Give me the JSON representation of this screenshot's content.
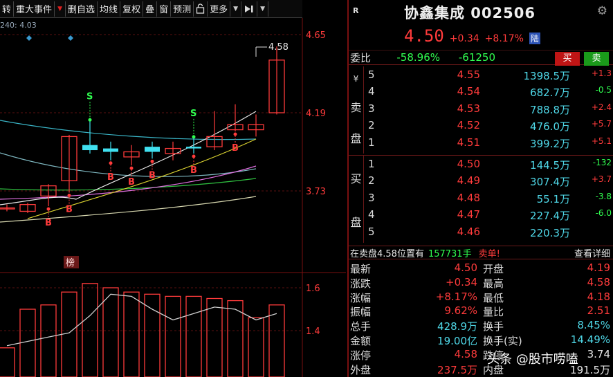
{
  "toolbar": {
    "items": [
      "转",
      "重大事件",
      "删自选",
      "均线",
      "复权",
      "叠",
      "窗",
      "预测",
      "更多"
    ],
    "lock_icon": "lock-icon",
    "play_icon": "play-to-end-icon"
  },
  "chart": {
    "ma_label": "240: 4.03",
    "price_ticks": [
      "4.65",
      "4.19",
      "3.73"
    ],
    "max_label": "4.58",
    "volume_ticks": [
      "1.6",
      "1.4"
    ],
    "bang_label": "榜",
    "buy_mark": "B",
    "sell_mark": "S"
  },
  "chart_data": {
    "type": "candlestick",
    "ylim": [
      3.5,
      4.7
    ],
    "candles": [
      {
        "open": 3.63,
        "close": 3.63,
        "high": 3.65,
        "low": 3.61
      },
      {
        "open": 3.61,
        "close": 3.65,
        "high": 3.66,
        "low": 3.6
      },
      {
        "open": 3.7,
        "close": 3.76,
        "high": 3.77,
        "low": 3.64
      },
      {
        "open": 3.79,
        "close": 4.05,
        "high": 4.06,
        "low": 3.72
      },
      {
        "open": 4.0,
        "close": 3.97,
        "high": 4.14,
        "low": 3.95
      },
      {
        "open": 3.98,
        "close": 3.96,
        "high": 4.02,
        "low": 3.91
      },
      {
        "open": 3.93,
        "close": 3.96,
        "high": 4.0,
        "low": 3.88
      },
      {
        "open": 3.99,
        "close": 3.96,
        "high": 4.02,
        "low": 3.92
      },
      {
        "open": 3.95,
        "close": 3.98,
        "high": 4.02,
        "low": 3.91
      },
      {
        "open": 3.99,
        "close": 3.98,
        "high": 4.04,
        "low": 3.95
      },
      {
        "open": 3.99,
        "close": 4.05,
        "high": 4.2,
        "low": 3.97
      },
      {
        "open": 4.09,
        "close": 4.12,
        "high": 4.24,
        "low": 4.08
      },
      {
        "open": 4.09,
        "close": 4.12,
        "high": 4.18,
        "low": 4.05
      },
      {
        "open": 4.19,
        "close": 4.5,
        "high": 4.58,
        "low": 4.18
      }
    ],
    "volume": [
      1.32,
      1.5,
      1.52,
      1.58,
      1.62,
      1.6,
      1.58,
      1.57,
      1.56,
      1.56,
      1.55,
      1.54,
      1.46,
      1.52
    ],
    "volume_line": [
      1.33,
      1.35,
      1.37,
      1.39,
      1.47,
      1.57,
      1.56,
      1.5,
      1.45,
      1.48,
      1.51,
      1.5,
      1.45,
      1.48
    ],
    "volume_ylim": [
      1.2,
      1.7
    ],
    "buy_signals": [
      2,
      3,
      5,
      6,
      7,
      9,
      11
    ],
    "sell_signals": [
      4,
      9
    ]
  },
  "quote": {
    "r_label": "R",
    "title": "协鑫集成 002506",
    "price": "4.50",
    "change": "+0.34",
    "change_pct": "+8.17%",
    "lu_badge": "陆",
    "weibi_label": "委比",
    "weibi_pct": "-58.96%",
    "weibi_diff": "-61250",
    "buy_btn": "买",
    "sell_btn": "卖",
    "ask_side_labels": [
      "¥",
      "卖",
      "盘"
    ],
    "bid_side_labels": [
      "买",
      "盘"
    ],
    "asks": [
      {
        "level": "5",
        "price": "4.55",
        "vol": "1398.5万",
        "delta": "+1.3"
      },
      {
        "level": "4",
        "price": "4.54",
        "vol": "682.7万",
        "delta": "-0.5"
      },
      {
        "level": "3",
        "price": "4.53",
        "vol": "788.8万",
        "delta": "+2.4"
      },
      {
        "level": "2",
        "price": "4.52",
        "vol": "476.0万",
        "delta": "+5.7"
      },
      {
        "level": "1",
        "price": "4.51",
        "vol": "399.2万",
        "delta": "+5.1"
      }
    ],
    "bids": [
      {
        "level": "1",
        "price": "4.50",
        "vol": "144.5万",
        "delta": "-132"
      },
      {
        "level": "2",
        "price": "4.49",
        "vol": "307.4万",
        "delta": "+3.7"
      },
      {
        "level": "3",
        "price": "4.48",
        "vol": "55.1万",
        "delta": "-3.8"
      },
      {
        "level": "4",
        "price": "4.47",
        "vol": "227.4万",
        "delta": "-6.0"
      },
      {
        "level": "5",
        "price": "4.46",
        "vol": "220.3万",
        "delta": ""
      }
    ],
    "info_line": {
      "text": "在卖盘4.58位置有",
      "qty": "157731手",
      "tag": "卖单!",
      "link": "查看详细"
    },
    "stats": [
      {
        "l1": "最新",
        "v1": "4.50",
        "c1": "red",
        "l2": "开盘",
        "v2": "4.19",
        "c2": "red"
      },
      {
        "l1": "涨跌",
        "v1": "+0.34",
        "c1": "red",
        "l2": "最高",
        "v2": "4.58",
        "c2": "red"
      },
      {
        "l1": "涨幅",
        "v1": "+8.17%",
        "c1": "red",
        "l2": "最低",
        "v2": "4.18",
        "c2": "red"
      },
      {
        "l1": "振幅",
        "v1": "9.62%",
        "c1": "red",
        "l2": "量比",
        "v2": "2.51",
        "c2": "red"
      },
      {
        "l1": "总手",
        "v1": "428.9万",
        "c1": "cyan",
        "l2": "换手",
        "v2": "8.45%",
        "c2": "cyan"
      },
      {
        "l1": "金额",
        "v1": "19.00亿",
        "c1": "cyan",
        "l2": "换手(实)",
        "v2": "14.49%",
        "c2": "cyan"
      },
      {
        "l1": "涨停",
        "v1": "4.58",
        "c1": "red",
        "l2": "跌停",
        "v2": "3.74",
        "c2": "white"
      },
      {
        "l1": "外盘",
        "v1": "237.5万",
        "c1": "red",
        "l2": "内盘",
        "v2": "191.5万",
        "c2": "white"
      }
    ]
  },
  "watermark": "头条 @股市唠嗑"
}
